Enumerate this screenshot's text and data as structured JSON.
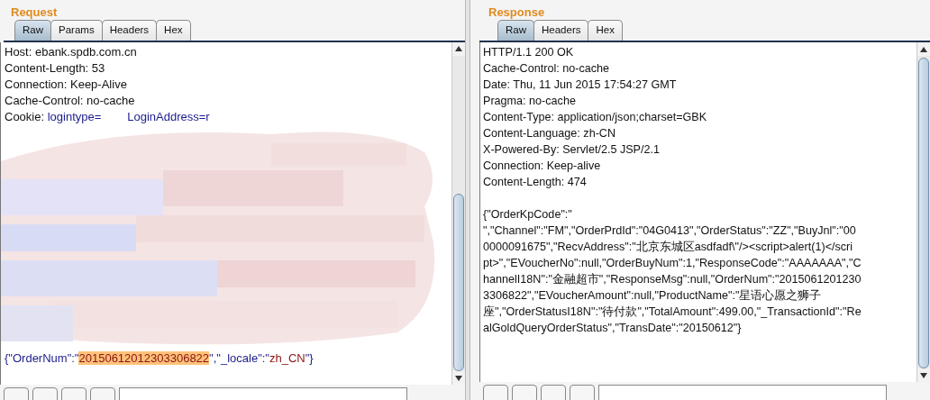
{
  "panes": [
    {
      "title": "Request",
      "tabs": [
        {
          "label": "Raw",
          "selected": true
        },
        {
          "label": "Params",
          "selected": false
        },
        {
          "label": "Headers",
          "selected": false
        },
        {
          "label": "Hex",
          "selected": false
        }
      ],
      "content": [
        {
          "kind": "line",
          "segments": [
            {
              "text": "Host: ebank.spdb.com.cn",
              "kind": "plain"
            }
          ]
        },
        {
          "kind": "line",
          "segments": [
            {
              "text": "Content-Length: 53",
              "kind": "plain"
            }
          ]
        },
        {
          "kind": "line",
          "segments": [
            {
              "text": "Connection: Keep-Alive",
              "kind": "plain"
            }
          ]
        },
        {
          "kind": "line",
          "segments": [
            {
              "text": "Cache-Control: no-cache",
              "kind": "plain"
            }
          ]
        },
        {
          "kind": "line",
          "segments": [
            {
              "text": "Cookie: ",
              "kind": "plain"
            },
            {
              "text": "logintype=",
              "kind": "param"
            },
            {
              "text": "LoginAddress=r",
              "kind": "param"
            }
          ]
        },
        {
          "kind": "redacted"
        },
        {
          "kind": "line",
          "segments": [
            {
              "text": "{\"OrderNum\":\"",
              "kind": "param"
            },
            {
              "text": "20150612012303306822",
              "kind": "match"
            },
            {
              "text": "\",\"_locale\":\"",
              "kind": "param"
            },
            {
              "text": "zh_CN",
              "kind": "value"
            },
            {
              "text": "\"}",
              "kind": "param"
            }
          ]
        }
      ]
    },
    {
      "title": "Response",
      "tabs": [
        {
          "label": "Raw",
          "selected": true
        },
        {
          "label": "Headers",
          "selected": false
        },
        {
          "label": "Hex",
          "selected": false
        }
      ],
      "content": [
        {
          "kind": "line",
          "segments": [
            {
              "text": "HTTP/1.1 200 OK",
              "kind": "plain"
            }
          ]
        },
        {
          "kind": "line",
          "segments": [
            {
              "text": "Cache-Control: no-cache",
              "kind": "plain"
            }
          ]
        },
        {
          "kind": "line",
          "segments": [
            {
              "text": "Date: Thu, 11 Jun 2015 17:54:27 GMT",
              "kind": "plain"
            }
          ]
        },
        {
          "kind": "line",
          "segments": [
            {
              "text": "Pragma: no-cache",
              "kind": "plain"
            }
          ]
        },
        {
          "kind": "line",
          "segments": [
            {
              "text": "Content-Type: application/json;charset=GBK",
              "kind": "plain"
            }
          ]
        },
        {
          "kind": "line",
          "segments": [
            {
              "text": "Content-Language: zh-CN",
              "kind": "plain"
            }
          ]
        },
        {
          "kind": "line",
          "segments": [
            {
              "text": "X-Powered-By: Servlet/2.5 JSP/2.1",
              "kind": "plain"
            }
          ]
        },
        {
          "kind": "line",
          "segments": [
            {
              "text": "Connection: Keep-alive",
              "kind": "plain"
            }
          ]
        },
        {
          "kind": "line",
          "segments": [
            {
              "text": "Content-Length: 474",
              "kind": "plain"
            }
          ]
        },
        {
          "kind": "blank"
        },
        {
          "kind": "line",
          "segments": [
            {
              "text": "{\"OrderKpCode\":\"",
              "kind": "plain"
            }
          ]
        },
        {
          "kind": "line",
          "segments": [
            {
              "text": "\",\"Channel\":\"FM\",\"OrderPrdId\":\"04G0413\",\"OrderStatus\":\"ZZ\",\"BuyJnl\":\"00",
              "kind": "plain"
            }
          ]
        },
        {
          "kind": "line",
          "segments": [
            {
              "text": "0000091675\",\"RecvAddress\":\"北京东城区asdfadf\\\"/><script>alert(1)</scri",
              "kind": "plain"
            }
          ]
        },
        {
          "kind": "line",
          "segments": [
            {
              "text": "pt>\",\"EVoucherNo\":null,\"OrderBuyNum\":1,\"ResponseCode\":\"AAAAAAA\",\"C",
              "kind": "plain"
            }
          ]
        },
        {
          "kind": "line",
          "segments": [
            {
              "text": "hannelI18N\":\"金融超市\",\"ResponseMsg\":null,\"OrderNum\":\"2015061201230",
              "kind": "plain"
            }
          ]
        },
        {
          "kind": "line",
          "segments": [
            {
              "text": "3306822\",\"EVoucherAmount\":null,\"ProductName\":\"星语心愿之狮子",
              "kind": "plain"
            }
          ]
        },
        {
          "kind": "line",
          "segments": [
            {
              "text": "座\",\"OrderStatusI18N\":\"待付款\",\"TotalAmount\":499.00,\"_TransactionId\":\"Re",
              "kind": "plain"
            }
          ]
        },
        {
          "kind": "line",
          "segments": [
            {
              "text": "alGoldQueryOrderStatus\",\"TransDate\":\"20150612\"}",
              "kind": "plain"
            }
          ]
        }
      ]
    }
  ]
}
